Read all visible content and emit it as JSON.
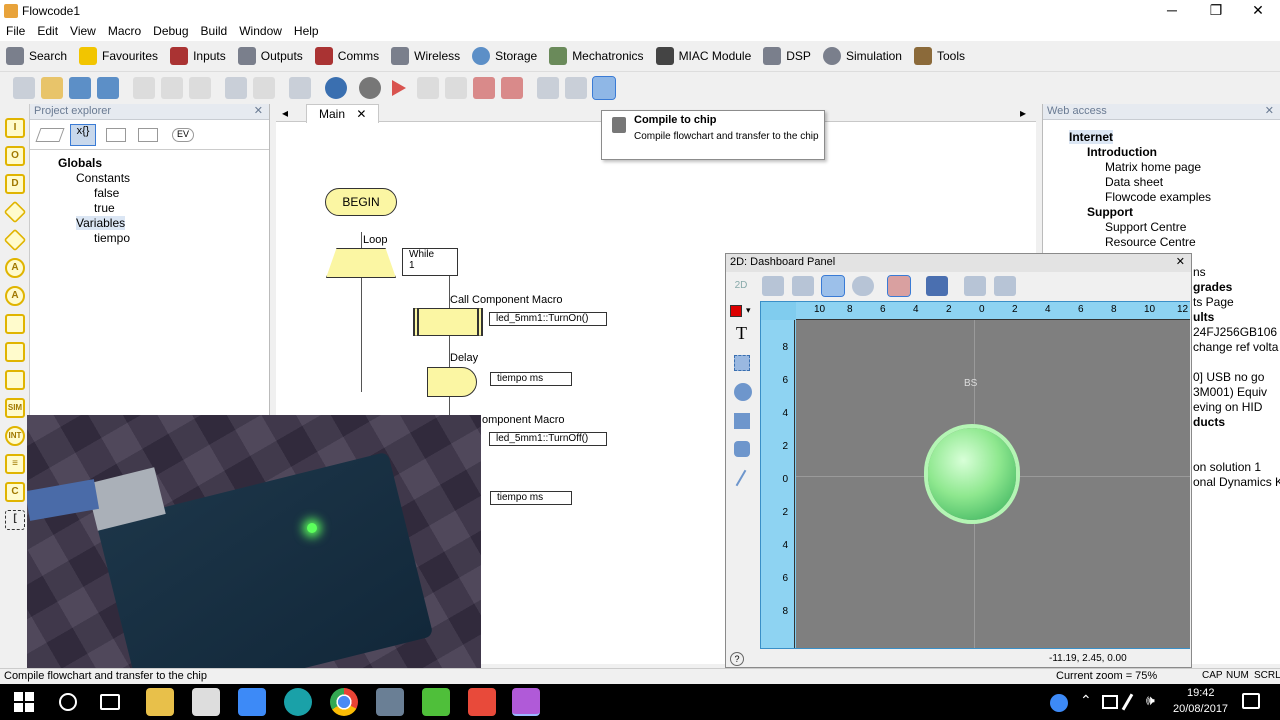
{
  "window": {
    "title": "Flowcode1"
  },
  "menu": [
    "File",
    "Edit",
    "View",
    "Macro",
    "Debug",
    "Build",
    "Window",
    "Help"
  ],
  "component_toolbar": [
    "Search",
    "Favourites",
    "Inputs",
    "Outputs",
    "Comms",
    "Wireless",
    "Storage",
    "Mechatronics",
    "MIAC Module",
    "DSP",
    "Simulation",
    "Tools"
  ],
  "project_explorer": {
    "title": "Project explorer",
    "tree": {
      "root": "Globals",
      "constants_label": "Constants",
      "constants": [
        "false",
        "true"
      ],
      "variables_label": "Variables",
      "variables": [
        "tiempo"
      ]
    }
  },
  "editor": {
    "tab": "Main",
    "flow": {
      "begin": "BEGIN",
      "loop_label": "Loop",
      "loop_cond": "While",
      "loop_value": "1",
      "macro1_label": "Call Component Macro",
      "macro1_call": "led_5mm1::TurnOn()",
      "delay1_label": "Delay",
      "delay1_param": "tiempo ms",
      "macro2_label": "omponent Macro",
      "macro2_call": "led_5mm1::TurnOff()",
      "delay2_param": "tiempo ms"
    }
  },
  "tooltip": {
    "title": "Compile to chip",
    "body": "Compile flowchart and transfer to the chip"
  },
  "web_access": {
    "title": "Web access",
    "root": "Internet",
    "intro": "Introduction",
    "intro_items": [
      "Matrix home page",
      "Data sheet",
      "Flowcode examples"
    ],
    "support": "Support",
    "support_items": [
      "Support Centre",
      "Resource Centre"
    ],
    "clipped": [
      "ns",
      "grades",
      "ts Page",
      "ults",
      "24FJ256GB106",
      "change ref volta",
      "0] USB no go",
      "3M001) Equiv",
      "eving on HID",
      "ducts",
      "on solution 1",
      "onal Dynamics Kit"
    ]
  },
  "dashboard": {
    "title": "2D: Dashboard Panel",
    "ruler_top": [
      "10",
      "8",
      "6",
      "4",
      "2",
      "0",
      "2",
      "4",
      "6",
      "8",
      "10",
      "12"
    ],
    "ruler_left": [
      "8",
      "6",
      "4",
      "2",
      "0",
      "2",
      "4",
      "6",
      "8"
    ],
    "component_label": "BS",
    "coords": "-11.19, 2.45, 0.00",
    "led_color": "#90ee90"
  },
  "status": {
    "message": "Compile flowchart and transfer to the chip",
    "zoom": "Current zoom = 75%",
    "flags": [
      "CAP",
      "NUM",
      "SCRL"
    ]
  },
  "taskbar": {
    "time": "19:42",
    "date": "20/08/2017"
  }
}
